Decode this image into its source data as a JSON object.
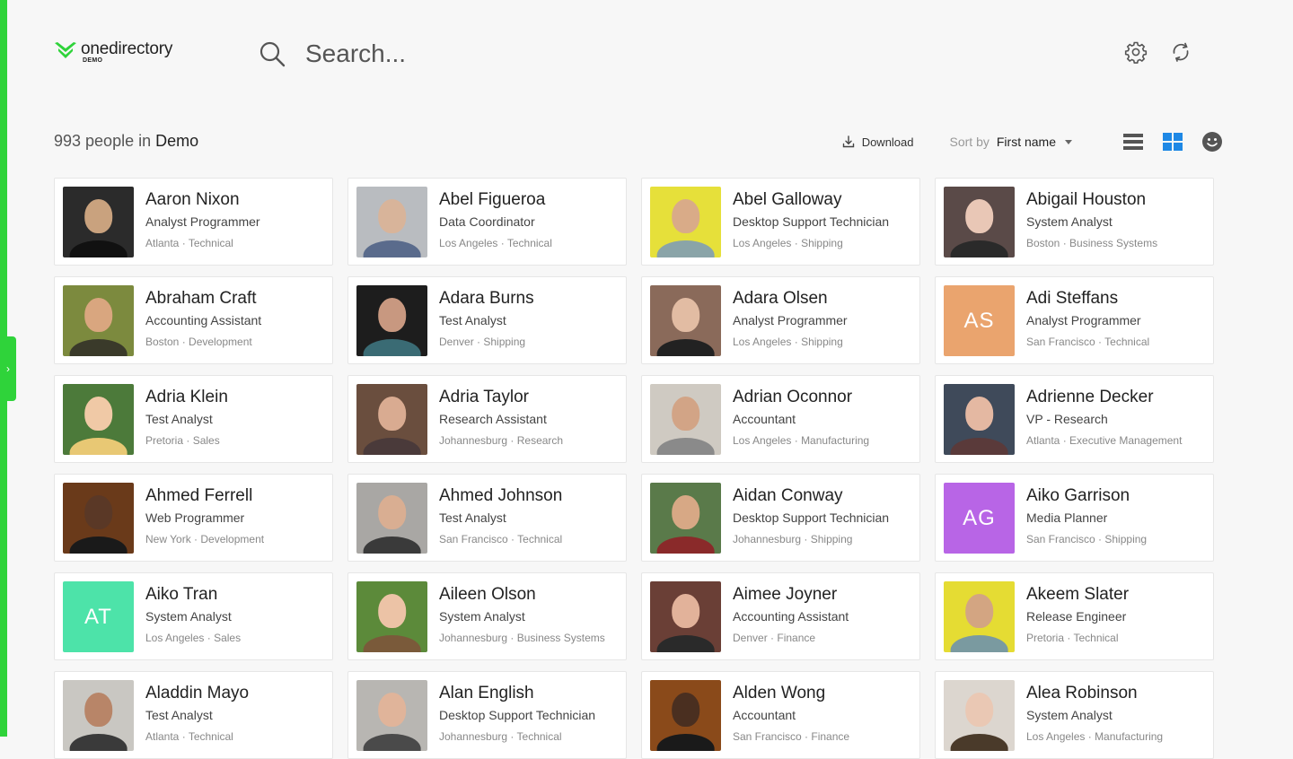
{
  "app": {
    "logo_name": "onedirectory",
    "logo_sub": "DEMO"
  },
  "search": {
    "placeholder": "Search..."
  },
  "header": {
    "count_prefix": "993 people in",
    "directory_name": "Demo"
  },
  "toolbar": {
    "download_label": "Download",
    "sort_label": "Sort by",
    "sort_value": "First name"
  },
  "colors": {
    "brand_green": "#2fd33a",
    "active_view": "#1e88e5"
  },
  "people": [
    {
      "name": "Aaron Nixon",
      "title": "Analyst Programmer",
      "location": "Atlanta",
      "department": "Technical",
      "avatar": "photo",
      "bg": "#2b2b2b",
      "skin": "#c9a27e",
      "shirt": "#111"
    },
    {
      "name": "Abel Figueroa",
      "title": "Data Coordinator",
      "location": "Los Angeles",
      "department": "Technical",
      "avatar": "photo",
      "bg": "#b9bcc0",
      "skin": "#d8b49a",
      "shirt": "#5a6b8c"
    },
    {
      "name": "Abel Galloway",
      "title": "Desktop Support Technician",
      "location": "Los Angeles",
      "department": "Shipping",
      "avatar": "photo",
      "bg": "#e6e03a",
      "skin": "#d9ab88",
      "shirt": "#8aa4a8"
    },
    {
      "name": "Abigail Houston",
      "title": "System Analyst",
      "location": "Boston",
      "department": "Business Systems",
      "avatar": "photo",
      "bg": "#5a4a48",
      "skin": "#e9c7b6",
      "shirt": "#2a2a2a"
    },
    {
      "name": "Abraham Craft",
      "title": "Accounting Assistant",
      "location": "Boston",
      "department": "Development",
      "avatar": "photo",
      "bg": "#7c8a3e",
      "skin": "#d9a67f",
      "shirt": "#3a3a2a"
    },
    {
      "name": "Adara Burns",
      "title": "Test Analyst",
      "location": "Denver",
      "department": "Shipping",
      "avatar": "photo",
      "bg": "#1d1d1d",
      "skin": "#c89880",
      "shirt": "#3a6b74"
    },
    {
      "name": "Adara Olsen",
      "title": "Analyst Programmer",
      "location": "Los Angeles",
      "department": "Shipping",
      "avatar": "photo",
      "bg": "#8a6a5a",
      "skin": "#e2bca3",
      "shirt": "#222"
    },
    {
      "name": "Adi Steffans",
      "title": "Analyst Programmer",
      "location": "San Francisco",
      "department": "Technical",
      "avatar": "initials",
      "initials": "AS",
      "bg": "#eaa46e"
    },
    {
      "name": "Adria Klein",
      "title": "Test Analyst",
      "location": "Pretoria",
      "department": "Sales",
      "avatar": "photo",
      "bg": "#4c7a3a",
      "skin": "#f0c9a6",
      "shirt": "#e8c874"
    },
    {
      "name": "Adria Taylor",
      "title": "Research Assistant",
      "location": "Johannesburg",
      "department": "Research",
      "avatar": "photo",
      "bg": "#6a4e3e",
      "skin": "#d9ab91",
      "shirt": "#4a3a3a"
    },
    {
      "name": "Adrian Oconnor",
      "title": "Accountant",
      "location": "Los Angeles",
      "department": "Manufacturing",
      "avatar": "photo",
      "bg": "#cfcac2",
      "skin": "#d2a486",
      "shirt": "#8a8a8a"
    },
    {
      "name": "Adrienne Decker",
      "title": "VP - Research",
      "location": "Atlanta",
      "department": "Executive Management",
      "avatar": "photo",
      "bg": "#3f4a5a",
      "skin": "#e4b8a2",
      "shirt": "#5a3a3a"
    },
    {
      "name": "Ahmed Ferrell",
      "title": "Web Programmer",
      "location": "New York",
      "department": "Development",
      "avatar": "photo",
      "bg": "#6a3a1a",
      "skin": "#5a3826",
      "shirt": "#1a1a1a"
    },
    {
      "name": "Ahmed Johnson",
      "title": "Test Analyst",
      "location": "San Francisco",
      "department": "Technical",
      "avatar": "photo",
      "bg": "#a9a7a4",
      "skin": "#d9ae92",
      "shirt": "#3a3a3a"
    },
    {
      "name": "Aidan Conway",
      "title": "Desktop Support Technician",
      "location": "Johannesburg",
      "department": "Shipping",
      "avatar": "photo",
      "bg": "#5a7a4a",
      "skin": "#d7a885",
      "shirt": "#8a2a2a"
    },
    {
      "name": "Aiko Garrison",
      "title": "Media Planner",
      "location": "San Francisco",
      "department": "Shipping",
      "avatar": "initials",
      "initials": "AG",
      "bg": "#b865e6"
    },
    {
      "name": "Aiko Tran",
      "title": "System Analyst",
      "location": "Los Angeles",
      "department": "Sales",
      "avatar": "initials",
      "initials": "AT",
      "bg": "#4de3a9"
    },
    {
      "name": "Aileen Olson",
      "title": "System Analyst",
      "location": "Johannesburg",
      "department": "Business Systems",
      "avatar": "photo",
      "bg": "#5c8a3a",
      "skin": "#ecc3a6",
      "shirt": "#7a5a3a"
    },
    {
      "name": "Aimee Joyner",
      "title": "Accounting Assistant",
      "location": "Denver",
      "department": "Finance",
      "avatar": "photo",
      "bg": "#6a3f36",
      "skin": "#e2b29a",
      "shirt": "#2a2a2a"
    },
    {
      "name": "Akeem Slater",
      "title": "Release Engineer",
      "location": "Pretoria",
      "department": "Technical",
      "avatar": "photo",
      "bg": "#e5dc33",
      "skin": "#d3a582",
      "shirt": "#7a9aa0"
    },
    {
      "name": "Aladdin Mayo",
      "title": "Test Analyst",
      "location": "Atlanta",
      "department": "Technical",
      "avatar": "photo",
      "bg": "#c9c7c2",
      "skin": "#b88568",
      "shirt": "#3a3a3a"
    },
    {
      "name": "Alan English",
      "title": "Desktop Support Technician",
      "location": "Johannesburg",
      "department": "Technical",
      "avatar": "photo",
      "bg": "#b8b6b2",
      "skin": "#e0b49a",
      "shirt": "#4a4a4a"
    },
    {
      "name": "Alden Wong",
      "title": "Accountant",
      "location": "San Francisco",
      "department": "Finance",
      "avatar": "photo",
      "bg": "#8a4a1a",
      "skin": "#4a2f20",
      "shirt": "#1a1a1a"
    },
    {
      "name": "Alea Robinson",
      "title": "System Analyst",
      "location": "Los Angeles",
      "department": "Manufacturing",
      "avatar": "photo",
      "bg": "#dcd6cf",
      "skin": "#eac8b4",
      "shirt": "#4a3a2a"
    }
  ]
}
